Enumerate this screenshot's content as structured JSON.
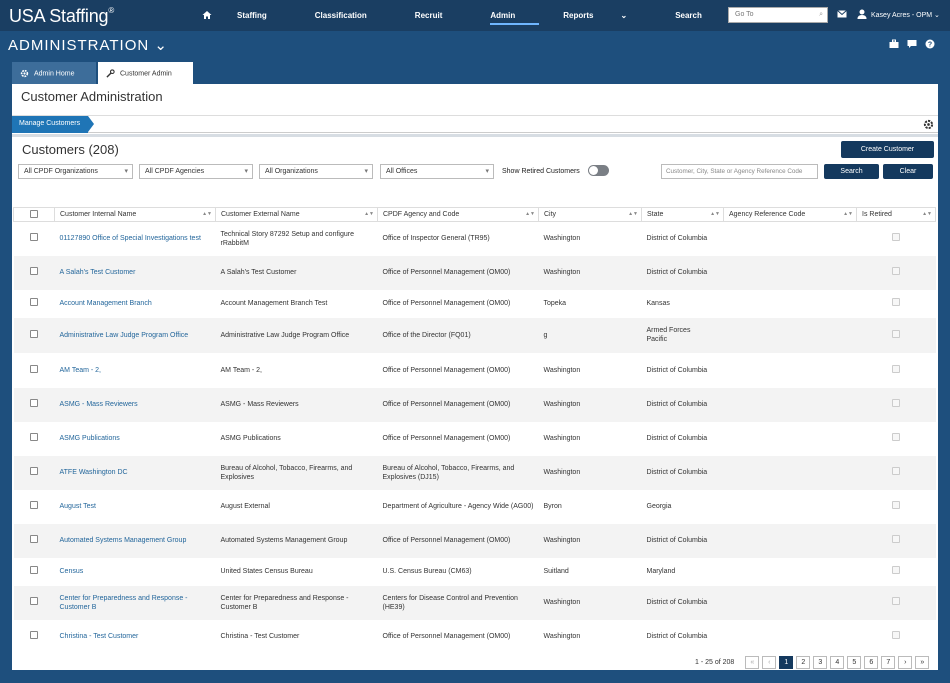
{
  "header": {
    "logo": "USA Staffing",
    "logo_mark": "®",
    "nav": [
      {
        "label": "Staffing",
        "active": false
      },
      {
        "label": "Classification",
        "active": false
      },
      {
        "label": "Recruit",
        "active": false
      },
      {
        "label": "Admin",
        "active": true
      },
      {
        "label": "Reports",
        "active": false
      },
      {
        "label": "Search",
        "active": false
      }
    ],
    "reports_caret": "⌄",
    "goto_placeholder": "Go To",
    "user": "Kasey Acres - OPM"
  },
  "subbar": {
    "title": "ADMINISTRATION",
    "caret": "⌄"
  },
  "tabs": [
    {
      "label": "Admin Home"
    },
    {
      "label": "Customer Admin"
    }
  ],
  "page": {
    "title": "Customer Administration",
    "breadcrumb": "Manage Customers",
    "list_title": "Customers (208)",
    "create_label": "Create Customer"
  },
  "filters": {
    "cpdf_orgs": "All CPDF Organizations",
    "cpdf_agencies": "All CPDF Agencies",
    "orgs": "All Organizations",
    "offices": "All Offices",
    "show_retired": "Show Retired Customers",
    "show_retired_on": false,
    "search_placeholder": "Customer, City, State or Agency Reference Code",
    "search_label": "Search",
    "clear_label": "Clear"
  },
  "table": {
    "columns": [
      "Customer Internal Name",
      "Customer External Name",
      "CPDF Agency and Code",
      "City",
      "State",
      "Agency Reference Code",
      "Is Retired"
    ],
    "rows": [
      {
        "internal": "01127890 Office of Special Investigations test",
        "external": "Technical Story 87292 Setup and configure rRabbitM",
        "cpdf": "Office of Inspector General (TR95)",
        "city": "Washington",
        "state": "District of Columbia",
        "ref": "",
        "h": 34
      },
      {
        "internal": "A Salah's Test Customer",
        "external": "A Salah's Test Customer",
        "cpdf": "Office of Personnel Management (OM00)",
        "city": "Washington",
        "state": "District of Columbia",
        "ref": "",
        "h": 34
      },
      {
        "internal": "Account Management Branch",
        "external": "Account Management Branch Test",
        "cpdf": "Office of Personnel Management (OM00)",
        "city": "Topeka",
        "state": "Kansas",
        "ref": "",
        "h": 28
      },
      {
        "internal": "Administrative Law Judge Program Office",
        "external": "Administrative Law Judge Program Office",
        "cpdf": "Office of the Director (FQ01)",
        "city": "g",
        "state": "Armed Forces Pacific",
        "ref": "",
        "h": 35
      },
      {
        "internal": "AM Team - 2,",
        "external": "AM Team - 2,",
        "cpdf": "Office of Personnel Management (OM00)",
        "city": "Washington",
        "state": "District of Columbia",
        "ref": "",
        "h": 35
      },
      {
        "internal": "ASMG - Mass Reviewers",
        "external": "ASMG - Mass Reviewers",
        "cpdf": "Office of Personnel Management (OM00)",
        "city": "Washington",
        "state": "District of Columbia",
        "ref": "",
        "h": 34
      },
      {
        "internal": "ASMG Publications",
        "external": "ASMG Publications",
        "cpdf": "Office of Personnel Management (OM00)",
        "city": "Washington",
        "state": "District of Columbia",
        "ref": "",
        "h": 34
      },
      {
        "internal": "ATFE Washington DC",
        "external": "Bureau of Alcohol, Tobacco, Firearms, and Explosives",
        "cpdf": "Bureau of Alcohol, Tobacco, Firearms, and Explosives (DJ15)",
        "city": "Washington",
        "state": "District of Columbia",
        "ref": "",
        "h": 34
      },
      {
        "internal": "August Test",
        "external": "August External",
        "cpdf": "Department of Agriculture - Agency Wide (AG00)",
        "city": "Byron",
        "state": "Georgia",
        "ref": "",
        "h": 34
      },
      {
        "internal": "Automated Systems Management Group",
        "external": "Automated Systems Management Group",
        "cpdf": "Office of Personnel Management (OM00)",
        "city": "Washington",
        "state": "District of Columbia",
        "ref": "",
        "h": 34
      },
      {
        "internal": "Census",
        "external": "United States Census Bureau",
        "cpdf": "U.S. Census Bureau (CM63)",
        "city": "Suitland",
        "state": "Maryland",
        "ref": "",
        "h": 28
      },
      {
        "internal": "Center for Preparedness and Response - Customer B",
        "external": "Center for Preparedness and Response - Customer B",
        "cpdf": "Centers for Disease Control and Prevention (HE39)",
        "city": "Washington",
        "state": "District of Columbia",
        "ref": "",
        "h": 34
      },
      {
        "internal": "Christina - Test Customer",
        "external": "Christina - Test Customer",
        "cpdf": "Office of Personnel Management (OM00)",
        "city": "Washington",
        "state": "District of Columbia",
        "ref": "",
        "h": 34
      }
    ]
  },
  "pager": {
    "info": "1 - 25 of 208",
    "first": "«",
    "prev": "‹",
    "pages": [
      "1",
      "2",
      "3",
      "4",
      "5",
      "6",
      "7"
    ],
    "current": "1",
    "next": "›",
    "last": "»"
  },
  "icons": {
    "home": "home-icon",
    "mail": "mail-icon",
    "user": "user-icon",
    "gear": "gear-icon",
    "wrench": "wrench-icon"
  },
  "colors": {
    "topbar": "#1a3e62",
    "subbar": "#1e4f7d",
    "primary": "#14395e",
    "link": "#23669b",
    "crumb": "#1f75b6"
  }
}
